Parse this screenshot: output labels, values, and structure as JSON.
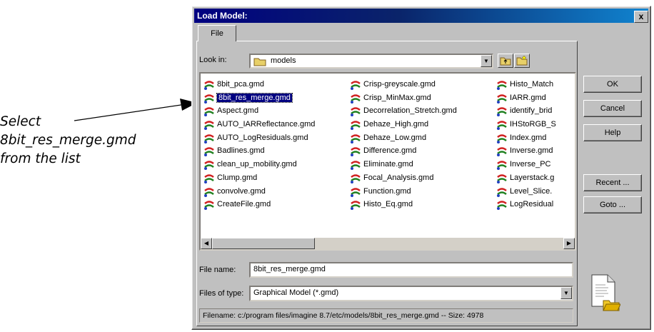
{
  "callout": {
    "lines": [
      "Select",
      "8bit_res_merge.gmd",
      "from the list"
    ]
  },
  "dialog": {
    "title": "Load Model:",
    "close_label": "x",
    "tab_label": "File",
    "look_in_label": "Look in:",
    "look_in_value": "models",
    "file_name_label": "File name:",
    "file_name_value": "8bit_res_merge.gmd",
    "files_of_type_label": "Files of type:",
    "files_of_type_value": "Graphical Model (*.gmd)",
    "status_text": "Filename: c:/program files/imagine 8.7/etc/models/8bit_res_merge.gmd -- Size: 4978",
    "buttons": {
      "ok": "OK",
      "cancel": "Cancel",
      "help": "Help",
      "recent": "Recent ...",
      "goto": "Goto ..."
    },
    "selected_item": "8bit_res_merge.gmd",
    "file_columns": [
      [
        "8bit_pca.gmd",
        "8bit_res_merge.gmd",
        "Aspect.gmd",
        "AUTO_IARReflectance.gmd",
        "AUTO_LogResiduals.gmd",
        "Badlines.gmd",
        "clean_up_mobility.gmd",
        "Clump.gmd",
        "convolve.gmd",
        "CreateFile.gmd"
      ],
      [
        "Crisp-greyscale.gmd",
        "Crisp_MinMax.gmd",
        "Decorrelation_Stretch.gmd",
        "Dehaze_High.gmd",
        "Dehaze_Low.gmd",
        "Difference.gmd",
        "Eliminate.gmd",
        "Focal_Analysis.gmd",
        "Function.gmd",
        "Histo_Eq.gmd"
      ],
      [
        "Histo_Match",
        "IARR.gmd",
        "identify_brid",
        "IHStoRGB_S",
        "Index.gmd",
        "Inverse.gmd",
        "Inverse_PC",
        "Layerstack.g",
        "Level_Slice.",
        "LogResidual"
      ]
    ]
  },
  "colors": {
    "title_start": "#000080",
    "title_end": "#1084d0",
    "selection": "#000080",
    "face": "#c0c0c0"
  },
  "icons": [
    "folder-icon",
    "up-folder-icon",
    "new-folder-icon",
    "model-file-icon",
    "open-document-icon"
  ]
}
